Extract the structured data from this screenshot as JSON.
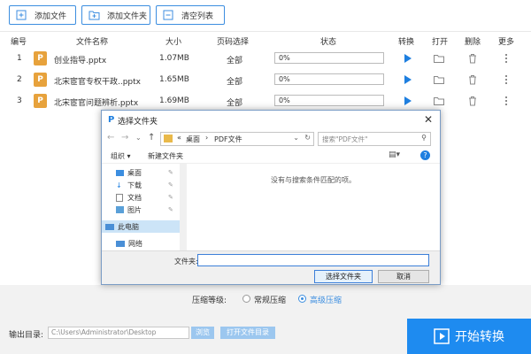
{
  "toolbar": {
    "add_file": "添加文件",
    "add_folder": "添加文件夹",
    "clear_list": "清空列表"
  },
  "table": {
    "headers": [
      "编号",
      "文件名称",
      "大小",
      "页码选择",
      "状态",
      "转换",
      "打开",
      "删除",
      "更多"
    ],
    "rows": [
      {
        "index": "1",
        "name": "创业指导.pptx",
        "size": "1.07MB",
        "pages": "全部",
        "progress_text": "0%",
        "progress": 0
      },
      {
        "index": "2",
        "name": "北宋宦官专权干政..pptx",
        "size": "1.65MB",
        "pages": "全部",
        "progress_text": "0%",
        "progress": 0
      },
      {
        "index": "3",
        "name": "北宋宦官问题辨析.pptx",
        "size": "1.69MB",
        "pages": "全部",
        "progress_text": "0%",
        "progress": 0
      }
    ],
    "file_icon_letter": "P"
  },
  "dialog": {
    "title": "选择文件夹",
    "path_prefix": "«",
    "path_seg1": "桌面",
    "path_sep": "›",
    "path_seg2": "PDF文件",
    "search_placeholder": "搜索\"PDF文件\"",
    "organize": "组织 ▾",
    "new_folder": "新建文件夹",
    "nav": {
      "desktop": "桌面",
      "downloads": "下载",
      "documents": "文档",
      "pictures": "图片",
      "this_pc": "此电脑",
      "network": "网络"
    },
    "empty_message": "没有与搜索条件匹配的项。",
    "folder_label": "文件夹:",
    "folder_value": "",
    "select_button": "选择文件夹",
    "cancel_button": "取消"
  },
  "compress": {
    "label": "压缩等级:",
    "option_normal": "常规压缩",
    "option_high": "高级压缩",
    "selected": "高级压缩"
  },
  "output": {
    "label": "输出目录:",
    "path": "C:\\Users\\Administrator\\Desktop",
    "browse": "浏览",
    "open_dir": "打开文件目录"
  },
  "start_button": "开始转换",
  "colors": {
    "accent": "#3c8ee0",
    "start_bg": "#1e8bf0",
    "file_icon": "#e7a23c"
  }
}
